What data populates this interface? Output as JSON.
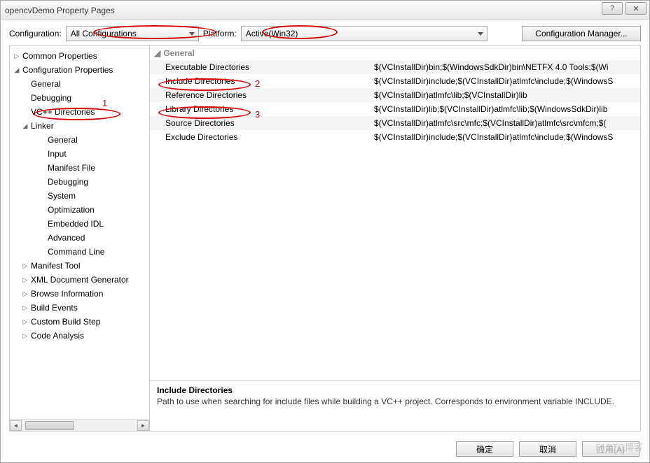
{
  "window": {
    "title": "opencvDemo Property Pages"
  },
  "toolbar": {
    "configuration_label": "Configuration:",
    "configuration_value": "All Configurations",
    "platform_label": "Platform:",
    "platform_value": "Active(Win32)",
    "config_manager": "Configuration Manager..."
  },
  "tree": {
    "items": [
      {
        "label": "Common Properties",
        "depth": 0,
        "exp": "▷"
      },
      {
        "label": "Configuration Properties",
        "depth": 0,
        "exp": "◢"
      },
      {
        "label": "General",
        "depth": 1,
        "exp": ""
      },
      {
        "label": "Debugging",
        "depth": 1,
        "exp": ""
      },
      {
        "label": "VC++ Directories",
        "depth": 1,
        "exp": ""
      },
      {
        "label": "Linker",
        "depth": 1,
        "exp": "◢"
      },
      {
        "label": "General",
        "depth": 2,
        "exp": ""
      },
      {
        "label": "Input",
        "depth": 2,
        "exp": ""
      },
      {
        "label": "Manifest File",
        "depth": 2,
        "exp": ""
      },
      {
        "label": "Debugging",
        "depth": 2,
        "exp": ""
      },
      {
        "label": "System",
        "depth": 2,
        "exp": ""
      },
      {
        "label": "Optimization",
        "depth": 2,
        "exp": ""
      },
      {
        "label": "Embedded IDL",
        "depth": 2,
        "exp": ""
      },
      {
        "label": "Advanced",
        "depth": 2,
        "exp": ""
      },
      {
        "label": "Command Line",
        "depth": 2,
        "exp": ""
      },
      {
        "label": "Manifest Tool",
        "depth": 1,
        "exp": "▷"
      },
      {
        "label": "XML Document Generator",
        "depth": 1,
        "exp": "▷"
      },
      {
        "label": "Browse Information",
        "depth": 1,
        "exp": "▷"
      },
      {
        "label": "Build Events",
        "depth": 1,
        "exp": "▷"
      },
      {
        "label": "Custom Build Step",
        "depth": 1,
        "exp": "▷"
      },
      {
        "label": "Code Analysis",
        "depth": 1,
        "exp": "▷"
      }
    ]
  },
  "grid": {
    "group": "General",
    "rows": [
      {
        "name": "Executable Directories",
        "value": "$(VCInstallDir)bin;$(WindowsSdkDir)bin\\NETFX 4.0 Tools;$(Wi"
      },
      {
        "name": "Include Directories",
        "value": "$(VCInstallDir)include;$(VCInstallDir)atlmfc\\include;$(WindowsS"
      },
      {
        "name": "Reference Directories",
        "value": "$(VCInstallDir)atlmfc\\lib;$(VCInstallDir)lib"
      },
      {
        "name": "Library Directories",
        "value": "$(VCInstallDir)lib;$(VCInstallDir)atlmfc\\lib;$(WindowsSdkDir)lib"
      },
      {
        "name": "Source Directories",
        "value": "$(VCInstallDir)atlmfc\\src\\mfc;$(VCInstallDir)atlmfc\\src\\mfcm;$("
      },
      {
        "name": "Exclude Directories",
        "value": "$(VCInstallDir)include;$(VCInstallDir)atlmfc\\include;$(WindowsS"
      }
    ]
  },
  "desc": {
    "title": "Include Directories",
    "text": "Path to use when searching for include files while building a VC++ project.  Corresponds to environment variable INCLUDE."
  },
  "footer": {
    "ok": "确定",
    "cancel": "取消",
    "apply": "应用(A)"
  },
  "annotations": {
    "n1": "1",
    "n2": "2",
    "n3": "3"
  },
  "watermark": "51CTO博客"
}
